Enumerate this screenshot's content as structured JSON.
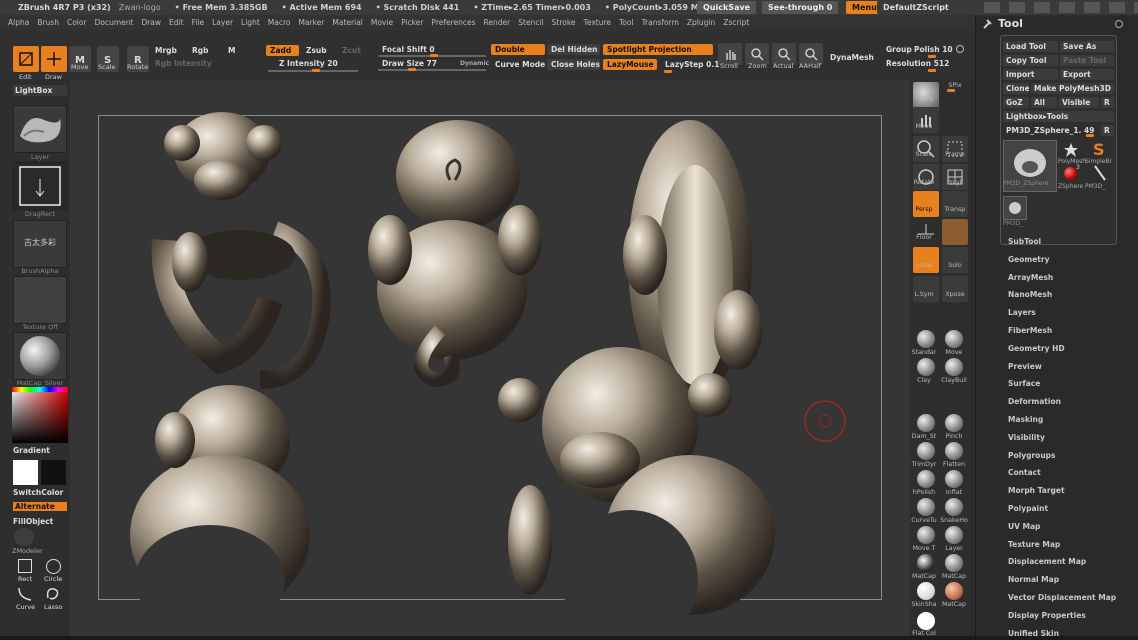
{
  "titlebar": {
    "app": "ZBrush 4R7 P3 (x32)",
    "subtitle": "Zwan-logo",
    "stats": [
      "• Free Mem 3.385GB",
      "• Active Mem 694",
      "• Scratch Disk 441",
      "• ZTime▸2.65 Timer▸0.003",
      "• PolyCount▸3.059 MP"
    ],
    "quicksave": "QuickSave",
    "seethrough": "See-through  0",
    "menus": "Menus",
    "script": "DefaultZScript"
  },
  "menubar": [
    "Alpha",
    "Brush",
    "Color",
    "Document",
    "Draw",
    "Edit",
    "File",
    "Layer",
    "Light",
    "Macro",
    "Marker",
    "Material",
    "Movie",
    "Picker",
    "Preferences",
    "Render",
    "Stencil",
    "Stroke",
    "Texture",
    "Tool",
    "Transform",
    "Zplugin",
    "Zscript"
  ],
  "toolbar": {
    "edit": "Edit",
    "draw": "Draw",
    "move": "Move",
    "scale": "Scale",
    "rotate": "Rotate",
    "mrgb": "Mrgb",
    "rgb": "Rgb",
    "m": "M",
    "rgb_intensity": "Rgb Intensity",
    "zadd": "Zadd",
    "zsub": "Zsub",
    "zcut": "Zcut",
    "z_intensity": "Z Intensity 20",
    "focal_shift": "Focal Shift 0",
    "draw_size": "Draw Size 77",
    "dynamic": "Dynamic",
    "double": "Double",
    "del_hidden": "Del Hidden",
    "spotlight": "Spotlight Projection",
    "curve_mode": "Curve Mode",
    "close_holes": "Close Holes",
    "lazymouse": "LazyMouse",
    "lazystep": "LazyStep 0.1",
    "scroll": "Scroll",
    "zoom": "Zoom",
    "actual": "Actual",
    "aahalf": "AAHalf",
    "dynamesh": "DynaMesh",
    "group": "Group",
    "polish": "Polish 10",
    "resolution": "Resolution 512"
  },
  "lefttray": {
    "lightbox": "LightBox",
    "layer": "Layer",
    "dragrect": "DragRect",
    "brushalpha": "BrushAlpha",
    "texture_off": "Texture Off",
    "material": "MatCap_Silver",
    "alpha_glyphs": "古太多彩",
    "gradient": "Gradient",
    "switchcolor": "SwitchColor",
    "alternate": "Alternate",
    "fillobject": "FillObject",
    "zmodeler": "ZModeler",
    "rect": "Rect",
    "circle": "Circle",
    "curve": "Curve",
    "lasso": "Lasso"
  },
  "righttools": {
    "bpr": "BPR",
    "spix": "SPix",
    "move": "Move",
    "scale": "Scale",
    "frame": "Frame",
    "rotate": "Rotate",
    "polyf": "PolyF",
    "persp": "Persp",
    "transp": "Transp",
    "floor": "Floor",
    "local": "Local",
    "solo": "Solo",
    "lsym": "L.Sym",
    "xpose": "Xpose",
    "brushes": [
      "Standar",
      "Move",
      "Clay",
      "ClayBuil",
      "Dam_St",
      "Pinch",
      "TrimDyr",
      "Flatten",
      "hPolish",
      "Inflat",
      "CurveTu",
      "SnakeHo",
      "Move T",
      "Layer",
      "MatCap",
      "MatCap",
      "SkinSha",
      "MatCap",
      "Flat Col"
    ]
  },
  "panel": {
    "title": "Tool",
    "load": "Load Tool",
    "saveas": "Save As",
    "copy": "Copy Tool",
    "paste": "Paste Tool",
    "import": "Import",
    "export": "Export",
    "clone": "Clone",
    "makepoly": "Make PolyMesh3D",
    "goz": "GoZ",
    "all": "All",
    "visible": "Visible",
    "r": "R",
    "lightbox_tools": "Lightbox▸Tools",
    "current": "PM3D_ZSphere_1. 49",
    "r2": "R",
    "thumbs": [
      "PM3D_ZSphere",
      "PolyMesh",
      "SimpleBr",
      "ZSphere",
      "PM3D_",
      "PM3D_"
    ],
    "count": "3",
    "menu": [
      "SubTool",
      "Geometry",
      "ArrayMesh",
      "NanoMesh",
      "Layers",
      "FiberMesh",
      "Geometry HD",
      "Preview",
      "Surface",
      "Deformation",
      "Masking",
      "Visibility",
      "Polygroups",
      "Contact",
      "Morph Target",
      "Polypaint",
      "UV Map",
      "Texture Map",
      "Displacement Map",
      "Normal Map",
      "Vector Displacement Map",
      "Display Properties",
      "Unified Skin"
    ]
  },
  "colors": {
    "accent": "#e8801e",
    "bg": "#2b2b2b",
    "metal": "#b9ad9c",
    "cursor": "#b02020"
  }
}
